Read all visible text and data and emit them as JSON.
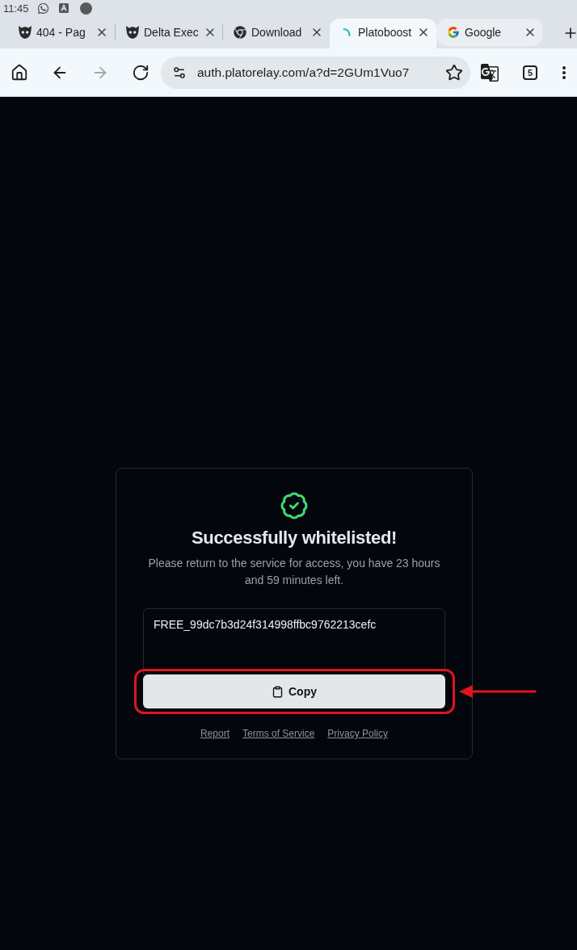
{
  "status_bar": {
    "time": "11:45"
  },
  "tabs": [
    {
      "kind": "creature",
      "title": "404 - Pag",
      "selected": false,
      "highlighted": false
    },
    {
      "kind": "creature",
      "title": "Delta Exec",
      "selected": false,
      "highlighted": false
    },
    {
      "kind": "chrome",
      "title": "Download",
      "selected": false,
      "highlighted": false
    },
    {
      "kind": "spinner",
      "title": "Platoboost",
      "selected": true,
      "highlighted": false
    },
    {
      "kind": "google",
      "title": "Google",
      "selected": false,
      "highlighted": true
    }
  ],
  "toolbar": {
    "nav_buttons": [
      {
        "kind": "home",
        "disabled": false
      },
      {
        "kind": "back",
        "disabled": false
      },
      {
        "kind": "forward",
        "disabled": true
      },
      {
        "kind": "reload",
        "disabled": false
      }
    ],
    "address_bar": {
      "url": "auth.platorelay.com/a?d=2GUm1Vuo7",
      "bookmarked": false
    },
    "tab_count": "5"
  },
  "card": {
    "title": "Successfully whitelisted!",
    "message": "Please return to the service for access, you have 23 hours and 59 minutes left.",
    "key_field": {
      "value": "FREE_99dc7b3d24f314998ffbc9762213cefc"
    },
    "copy_button": {
      "label": "Copy"
    },
    "links": [
      "Report",
      "Terms of Service",
      "Privacy Policy"
    ]
  }
}
